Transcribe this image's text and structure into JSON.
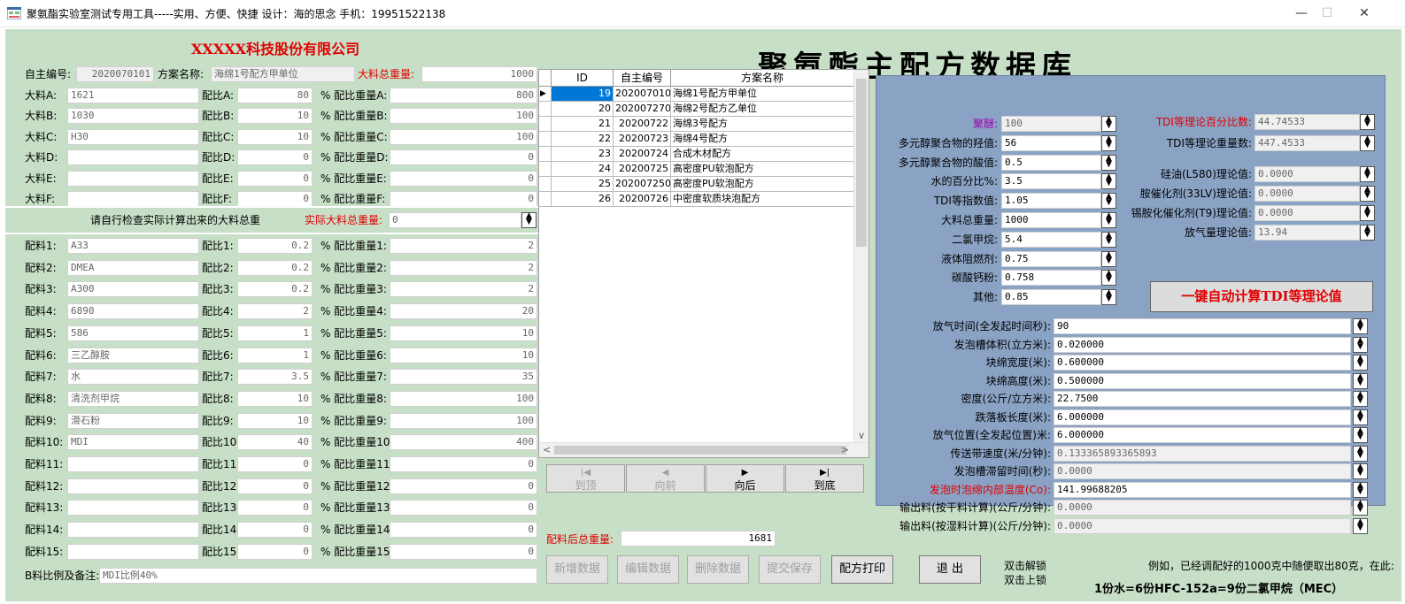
{
  "window": {
    "title": "聚氨酯实验室测试专用工具-----实用、方便、快捷   设计：海的思念    手机：19951522138",
    "minimize": "—",
    "maximize": "☐",
    "close": "✕"
  },
  "company": "XXXXX科技股份有限公司",
  "main_title": "聚氨酯主配方数据库",
  "header": {
    "self_no_label": "自主编号:",
    "self_no_value": "2020070101",
    "scheme_label": "方案名称:",
    "scheme_value": "海绵1号配方甲单位",
    "total_label": "大料总重量:",
    "total_value": "1000"
  },
  "big_materials": [
    {
      "label": "大料A:",
      "name": "1621",
      "ratio_label": "配比A:",
      "ratio": "80",
      "weight_label": "% 配比重量A:",
      "weight": "800"
    },
    {
      "label": "大料B:",
      "name": "1030",
      "ratio_label": "配比B:",
      "ratio": "10",
      "weight_label": "% 配比重量B:",
      "weight": "100"
    },
    {
      "label": "大料C:",
      "name": "H30",
      "ratio_label": "配比C:",
      "ratio": "10",
      "weight_label": "% 配比重量C:",
      "weight": "100"
    },
    {
      "label": "大料D:",
      "name": "",
      "ratio_label": "配比D:",
      "ratio": "0",
      "weight_label": "% 配比重量D:",
      "weight": "0"
    },
    {
      "label": "大料E:",
      "name": "",
      "ratio_label": "配比E:",
      "ratio": "0",
      "weight_label": "% 配比重量E:",
      "weight": "0"
    },
    {
      "label": "大料F:",
      "name": "",
      "ratio_label": "配比F:",
      "ratio": "0",
      "weight_label": "% 配比重量F:",
      "weight": "0"
    }
  ],
  "check": {
    "hint": "请自行检查实际计算出来的大料总重",
    "actual_label": "实际大料总重量:",
    "actual_value": "0"
  },
  "ingredients": [
    {
      "label": "配料1:",
      "name": "A33",
      "ratio_label": "配比1:",
      "ratio": "0.2",
      "weight_label": "% 配比重量1:",
      "weight": "2"
    },
    {
      "label": "配料2:",
      "name": "DMEA",
      "ratio_label": "配比2:",
      "ratio": "0.2",
      "weight_label": "% 配比重量2:",
      "weight": "2"
    },
    {
      "label": "配料3:",
      "name": "A300",
      "ratio_label": "配比3:",
      "ratio": "0.2",
      "weight_label": "% 配比重量3:",
      "weight": "2"
    },
    {
      "label": "配料4:",
      "name": "6890",
      "ratio_label": "配比4:",
      "ratio": "2",
      "weight_label": "% 配比重量4:",
      "weight": "20"
    },
    {
      "label": "配料5:",
      "name": "586",
      "ratio_label": "配比5:",
      "ratio": "1",
      "weight_label": "% 配比重量5:",
      "weight": "10"
    },
    {
      "label": "配料6:",
      "name": "三乙醇胺",
      "ratio_label": "配比6:",
      "ratio": "1",
      "weight_label": "% 配比重量6:",
      "weight": "10"
    },
    {
      "label": "配料7:",
      "name": "水",
      "ratio_label": "配比7:",
      "ratio": "3.5",
      "weight_label": "% 配比重量7:",
      "weight": "35"
    },
    {
      "label": "配料8:",
      "name": "清洗剂甲烷",
      "ratio_label": "配比8:",
      "ratio": "10",
      "weight_label": "% 配比重量8:",
      "weight": "100"
    },
    {
      "label": "配料9:",
      "name": "滑石粉",
      "ratio_label": "配比9:",
      "ratio": "10",
      "weight_label": "% 配比重量9:",
      "weight": "100"
    },
    {
      "label": "配料10:",
      "name": "MDI",
      "ratio_label": "配比10",
      "ratio": "40",
      "weight_label": "% 配比重量10:",
      "weight": "400"
    },
    {
      "label": "配料11:",
      "name": "",
      "ratio_label": "配比11",
      "ratio": "0",
      "weight_label": "% 配比重量11:",
      "weight": "0"
    },
    {
      "label": "配料12:",
      "name": "",
      "ratio_label": "配比12",
      "ratio": "0",
      "weight_label": "% 配比重量12:",
      "weight": "0"
    },
    {
      "label": "配料13:",
      "name": "",
      "ratio_label": "配比13",
      "ratio": "0",
      "weight_label": "% 配比重量13:",
      "weight": "0"
    },
    {
      "label": "配料14:",
      "name": "",
      "ratio_label": "配比14",
      "ratio": "0",
      "weight_label": "% 配比重量14:",
      "weight": "0"
    },
    {
      "label": "配料15:",
      "name": "",
      "ratio_label": "配比15",
      "ratio": "0",
      "weight_label": "% 配比重量15:",
      "weight": "0"
    }
  ],
  "remark": {
    "label": "B料比例及备注:",
    "value": "MDI比例40%"
  },
  "grid": {
    "headers": [
      "ID",
      "自主编号",
      "方案名称"
    ],
    "rows": [
      {
        "id": "19",
        "no": "2020070101",
        "name": "海绵1号配方甲单位"
      },
      {
        "id": "20",
        "no": "2020072701",
        "name": "海绵2号配方乙单位"
      },
      {
        "id": "21",
        "no": "20200722",
        "name": "海绵3号配方"
      },
      {
        "id": "22",
        "no": "20200723",
        "name": "海绵4号配方"
      },
      {
        "id": "23",
        "no": "20200724",
        "name": "合成木材配方"
      },
      {
        "id": "24",
        "no": "20200725",
        "name": "高密度PU软泡配方"
      },
      {
        "id": "25",
        "no": "2020072501",
        "name": "高密度PU软泡配方"
      },
      {
        "id": "26",
        "no": "20200726",
        "name": "中密度软质块泡配方"
      }
    ]
  },
  "nav": [
    {
      "icon": "|◀",
      "label": "到顶",
      "enabled": false
    },
    {
      "icon": "◀",
      "label": "向前",
      "enabled": false
    },
    {
      "icon": "▶",
      "label": "向后",
      "enabled": true
    },
    {
      "icon": "▶|",
      "label": "到底",
      "enabled": true
    }
  ],
  "after_total": {
    "label": "配料后总重量:",
    "value": "1681"
  },
  "actions": {
    "add": "新增数据",
    "edit": "编辑数据",
    "delete": "删除数据",
    "save": "提交保存",
    "print": "配方打印",
    "exit": "退  出",
    "unlock": "双击解锁",
    "lock": "双击上锁"
  },
  "params": [
    {
      "label": "聚醚:",
      "value": "100"
    },
    {
      "label": "多元醇聚合物的羟值:",
      "value": "56"
    },
    {
      "label": "多元醇聚合物的酸值:",
      "value": "0.5"
    },
    {
      "label": "水的百分比%:",
      "value": "3.5"
    },
    {
      "label": "TDI等指数值:",
      "value": "1.05"
    },
    {
      "label": "大料总重量:",
      "value": "1000"
    },
    {
      "label": "二氯甲烷:",
      "value": "5.4"
    },
    {
      "label": "液体阻燃剂:",
      "value": "0.75"
    },
    {
      "label": "碳酸钙粉:",
      "value": "0.758"
    },
    {
      "label": "其他:",
      "value": "0.85"
    }
  ],
  "results": [
    {
      "label": "TDI等理论百分比数:",
      "value": "44.74533"
    },
    {
      "label": "TDI等理论重量数:",
      "value": "447.4533"
    },
    {
      "label": "硅油(L580)理论值:",
      "value": "0.0000"
    },
    {
      "label": "胺催化剂(33LV)理论值:",
      "value": "0.0000"
    },
    {
      "label": "锡胺化催化剂(T9)理论值:",
      "value": "0.0000"
    },
    {
      "label": "放气量理论值:",
      "value": "13.94"
    }
  ],
  "calc_button": "一键自动计算TDI等理论值",
  "foam": [
    {
      "label": "放气时间(全发起时间秒):",
      "value": "90"
    },
    {
      "label": "发泡槽体积(立方米):",
      "value": "0.020000"
    },
    {
      "label": "块绵宽度(米):",
      "value": "0.600000"
    },
    {
      "label": "块绵高度(米):",
      "value": "0.500000"
    },
    {
      "label": "密度(公斤/立方米):",
      "value": "22.7500"
    },
    {
      "label": "跌落板长度(米):",
      "value": "6.000000"
    },
    {
      "label": "放气位置(全发起位置)米:",
      "value": "6.000000"
    },
    {
      "label": "传送带速度(米/分钟):",
      "value": "0.133365893365893"
    },
    {
      "label": "发泡槽滞留时间(秒):",
      "value": "0.0000"
    },
    {
      "label": "发泡时泡绵内部温度(Co):",
      "value": "141.99688205"
    },
    {
      "label": "输出料(按干料计算)(公斤/分钟):",
      "value": "0.0000"
    },
    {
      "label": "输出料(按湿料计算)(公斤/分钟):",
      "value": "0.0000"
    }
  ],
  "notes": {
    "example": "例如，已经调配好的1000克中随便取出80克，在此:",
    "formula": "1份水=6份HFC-152a=9份二氯甲烷（MEC）"
  },
  "colors": {
    "form_bg": "#c7dfc7",
    "panel_bg": "#8aa3c4",
    "accent_red": "#e00000",
    "selection": "#0078d7"
  }
}
